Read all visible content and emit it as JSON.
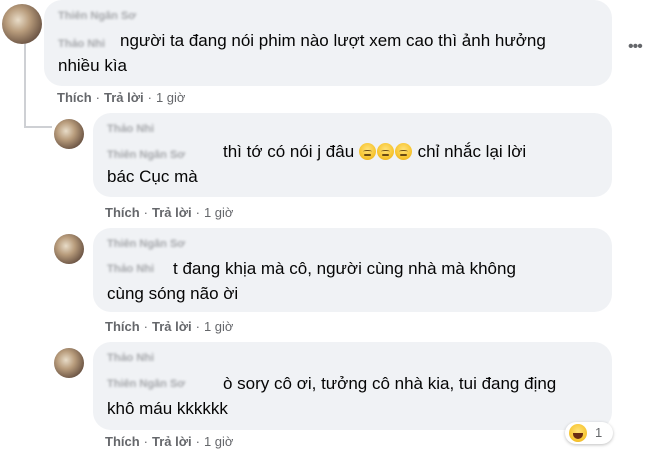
{
  "comments": [
    {
      "name": "Thiên Ngân Sơ",
      "tag": "Thảo Nhi",
      "lines": [
        "người ta đang nói phim nào lượt xem cao thì ảnh hưởng",
        "nhiều kìa"
      ],
      "like": "Thích",
      "reply": "Trả lời",
      "time": "1 giờ"
    },
    {
      "name": "Thảo Nhi",
      "tag": "Thiên Ngân Sơ",
      "lines": [
        "thì tớ có nói j đâu",
        "chỉ nhắc lại lời",
        "bác Cục mà"
      ],
      "like": "Thích",
      "reply": "Trả lời",
      "time": "1 giờ"
    },
    {
      "name": "Thiên Ngân Sơ",
      "tag": "Thảo Nhi",
      "lines": [
        "t đang khịa mà cô, người cùng nhà mà không",
        "cùng sóng não ời"
      ],
      "like": "Thích",
      "reply": "Trả lời",
      "time": "1 giờ"
    },
    {
      "name": "Thảo Nhi",
      "tag": "Thiên Ngân Sơ",
      "lines": [
        "ò sory cô ơi, tưởng cô nhà kia, tui đang địng",
        "khô máu kkkkkk"
      ],
      "like": "Thích",
      "reply": "Trả lời",
      "time": "1 giờ",
      "reaction": {
        "icon": "haha-reaction-icon",
        "count": "1"
      }
    }
  ],
  "more_icon": "more-options-icon"
}
